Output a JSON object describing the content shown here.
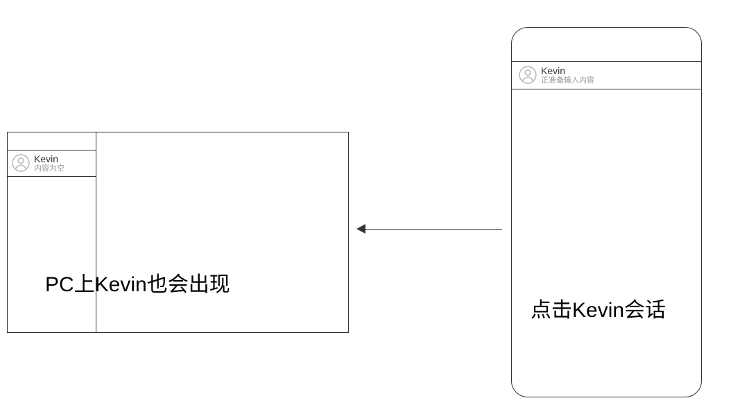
{
  "pc": {
    "chat_item": {
      "name": "Kevin",
      "status": "内容为空"
    },
    "caption": "PC上Kevin也会出现"
  },
  "mobile": {
    "chat_item": {
      "name": "Kevin",
      "status": "正准备输入内容"
    },
    "caption": "点击Kevin会话"
  }
}
